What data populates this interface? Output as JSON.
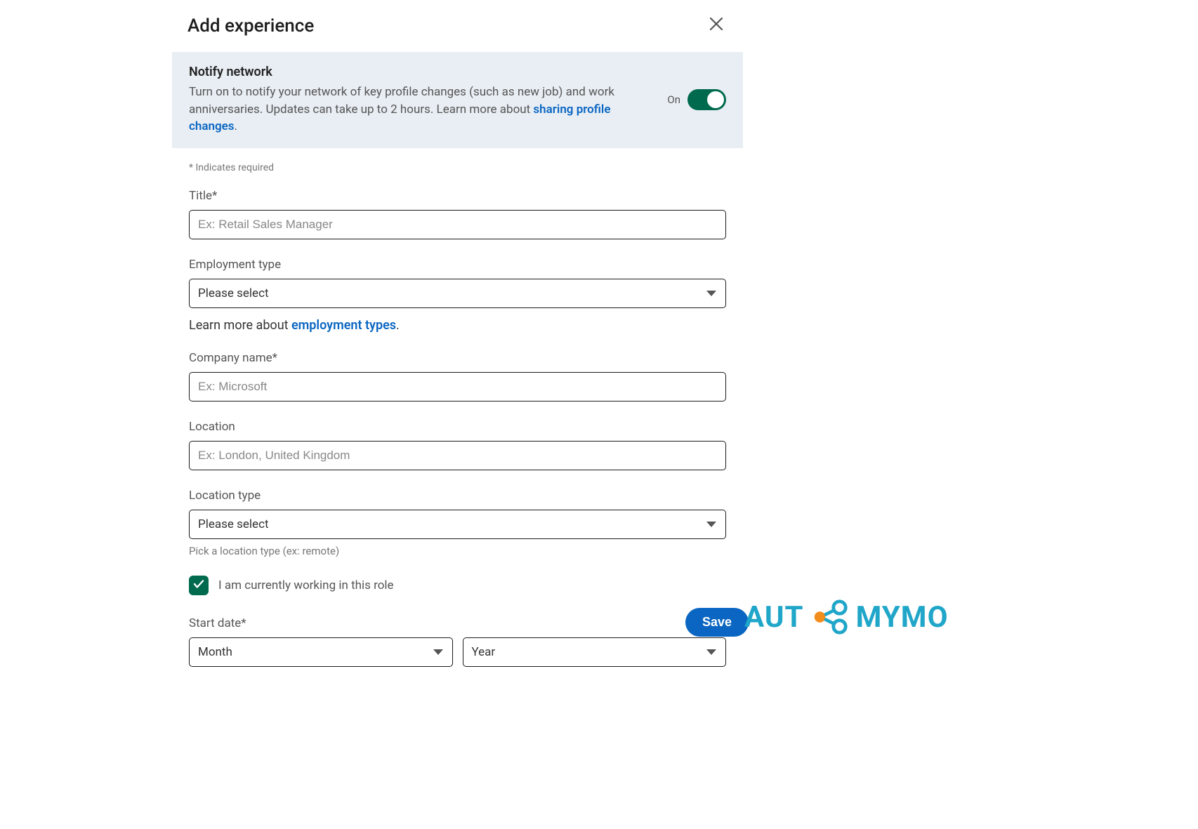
{
  "header": {
    "title": "Add experience"
  },
  "notify": {
    "title": "Notify network",
    "desc_before": "Turn on to notify your network of key profile changes (such as new job) and work anniversaries. Updates can take up to 2 hours. Learn more about ",
    "link_text": "sharing profile changes",
    "desc_after": ".",
    "toggle_state_label": "On"
  },
  "required_note": "* Indicates required",
  "fields": {
    "title": {
      "label": "Title*",
      "placeholder": "Ex: Retail Sales Manager"
    },
    "employment_type": {
      "label": "Employment type",
      "selected": "Please select",
      "helper_prefix": "Learn more about ",
      "helper_link": "employment types",
      "helper_suffix": "."
    },
    "company": {
      "label": "Company name*",
      "placeholder": "Ex: Microsoft"
    },
    "location": {
      "label": "Location",
      "placeholder": "Ex: London, United Kingdom"
    },
    "location_type": {
      "label": "Location type",
      "selected": "Please select",
      "helper": "Pick a location type (ex: remote)"
    },
    "current_role": {
      "label": "I am currently working in this role",
      "checked": true
    },
    "start_date": {
      "label": "Start date*",
      "month_placeholder": "Month",
      "year_placeholder": "Year"
    }
  },
  "footer": {
    "save_label": "Save"
  },
  "watermark": {
    "auto": "AUT",
    "mymo": "MYMO"
  }
}
